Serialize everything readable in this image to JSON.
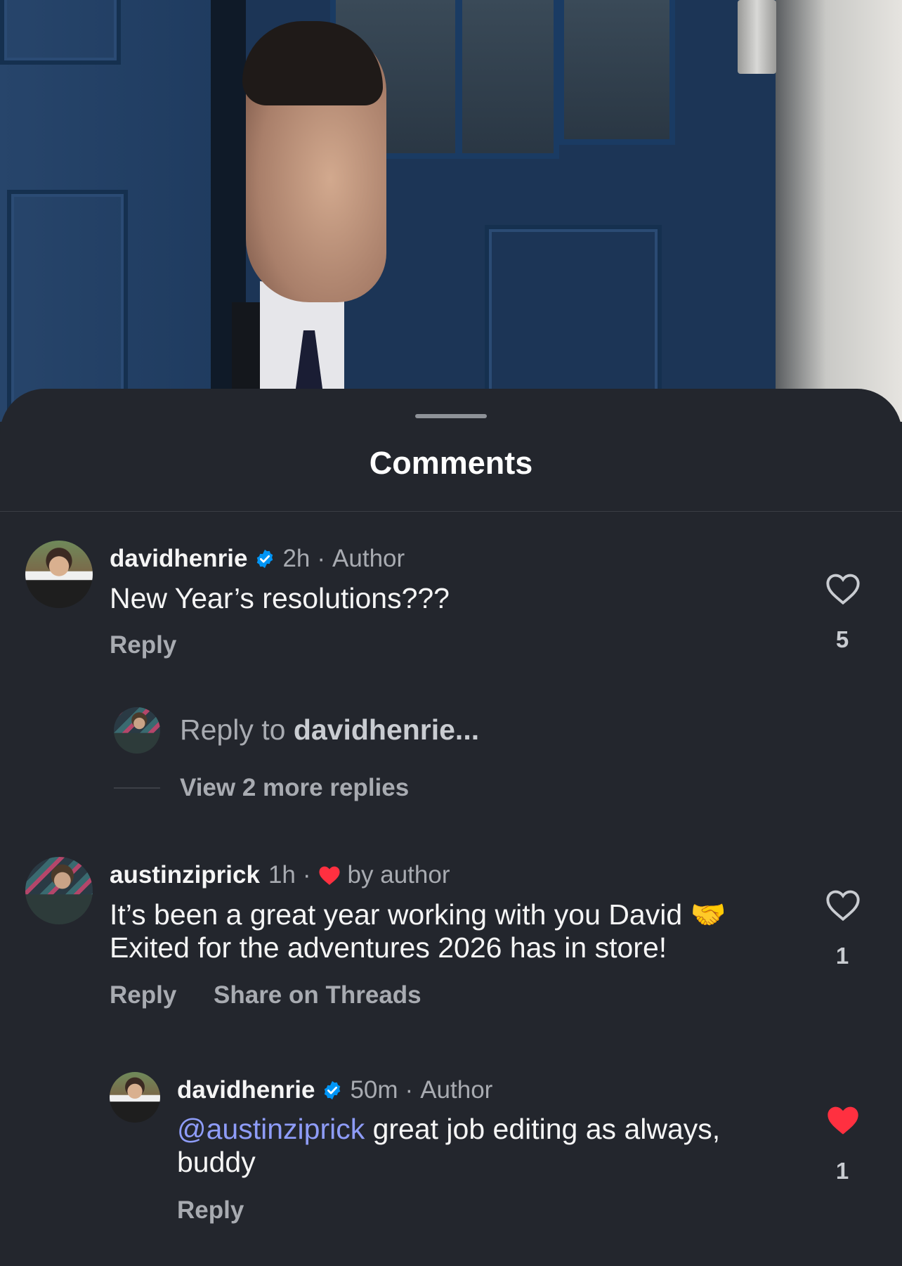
{
  "sheet": {
    "title": "Comments"
  },
  "comments": [
    {
      "username": "davidhenrie",
      "verified": true,
      "time": "2h",
      "separator": "·",
      "tag": "Author",
      "text": "New Year’s resolutions???",
      "reply_label": "Reply",
      "likes": "5",
      "liked": false,
      "reply_input": {
        "prefix": "Reply to ",
        "target": "davidhenrie..."
      },
      "view_more": "View 2 more replies"
    },
    {
      "username": "austinziprick",
      "verified": false,
      "time": "1h",
      "separator": "·",
      "liked_by_author": "by author",
      "text_line1": "It’s been a great year working with you David 🤝",
      "text_line2": "Exited for the adventures 2026 has in store!",
      "reply_label": "Reply",
      "share_label": "Share on Threads",
      "likes": "1",
      "liked": false
    },
    {
      "username": "davidhenrie",
      "verified": true,
      "time": "50m",
      "separator": "·",
      "tag": "Author",
      "mention": "@austinziprick",
      "text_rest": " great job editing as always,",
      "text_line2": "buddy",
      "reply_label": "Reply",
      "likes": "1",
      "liked": true
    }
  ],
  "colors": {
    "accent_mention": "#8e9cf8",
    "heart_red": "#ff3040",
    "verified_blue": "#0095f6"
  },
  "icons": [
    "verified-badge-icon",
    "heart-outline-icon",
    "heart-filled-icon"
  ]
}
